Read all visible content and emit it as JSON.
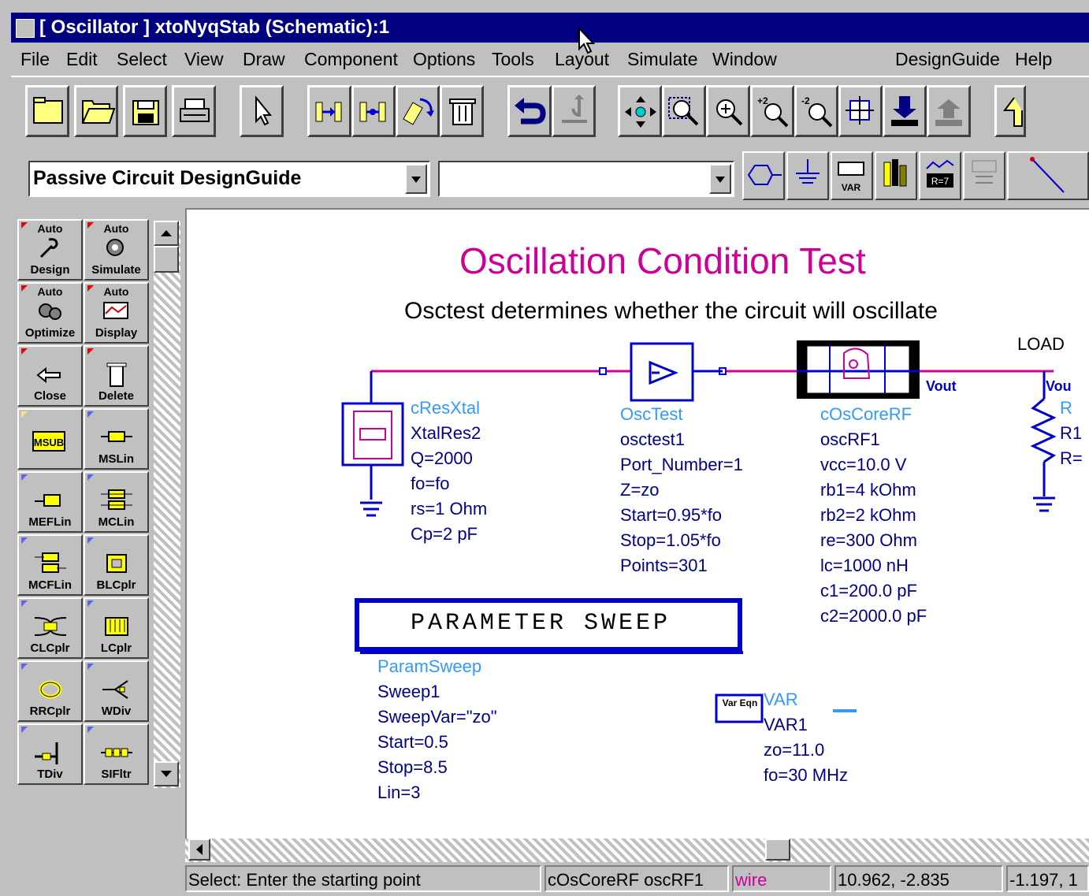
{
  "window": {
    "title": "[ Oscillator ] xtoNyqStab (Schematic):1"
  },
  "menu": [
    "File",
    "Edit",
    "Select",
    "View",
    "Draw",
    "Component",
    "Options",
    "Tools",
    "Layout",
    "Simulate",
    "Window",
    "DesignGuide",
    "Help"
  ],
  "toolbar1_icons": [
    "new-icon",
    "open-icon",
    "save-icon",
    "print-icon",
    "select-arrow-icon",
    "insert-left-icon",
    "insert-right-icon",
    "rotate-icon",
    "delete-icon",
    "undo-icon",
    "redo-icon",
    "pan-icon",
    "zoom-area-icon",
    "zoom-point-icon",
    "zoom-in-icon",
    "zoom-out-icon",
    "zoom-fit-icon",
    "push-down-icon",
    "pop-up-icon"
  ],
  "toolbar2": {
    "palette_combo_value": "Passive Circuit DesignGuide",
    "component_combo_value": "",
    "icons": [
      "port-icon",
      "ground-icon",
      "var-icon",
      "simulate-icon",
      "display-icon",
      "sweep-icon",
      "wire-icon"
    ],
    "var_label": "VAR"
  },
  "palette": [
    {
      "label": "Design",
      "auto": "Auto",
      "icon": "wrench-icon"
    },
    {
      "label": "Simulate",
      "auto": "Auto",
      "icon": "gears-icon"
    },
    {
      "label": "Optimize",
      "auto": "Auto",
      "icon": "gears-icon"
    },
    {
      "label": "Display",
      "auto": "Auto",
      "icon": "display-icon"
    },
    {
      "label": "Close",
      "auto": "",
      "icon": "arrow-left-icon"
    },
    {
      "label": "Delete",
      "auto": "",
      "icon": "trash-icon"
    },
    {
      "label": "MSUB",
      "auto": "",
      "icon": "msub-icon"
    },
    {
      "label": "MSLin",
      "auto": "",
      "icon": "line-icon"
    },
    {
      "label": "MEFLin",
      "auto": "",
      "icon": "line-icon"
    },
    {
      "label": "MCLin",
      "auto": "",
      "icon": "coupled-line-icon"
    },
    {
      "label": "MCFLin",
      "auto": "",
      "icon": "coupled-line-icon"
    },
    {
      "label": "BLCplr",
      "auto": "",
      "icon": "coupler-icon"
    },
    {
      "label": "CLCplr",
      "auto": "",
      "icon": "coupler-icon"
    },
    {
      "label": "LCplr",
      "auto": "",
      "icon": "lange-icon"
    },
    {
      "label": "RRCplr",
      "auto": "",
      "icon": "ring-icon"
    },
    {
      "label": "WDiv",
      "auto": "",
      "icon": "divider-icon"
    },
    {
      "label": "TDiv",
      "auto": "",
      "icon": "tee-icon"
    },
    {
      "label": "SIFltr",
      "auto": "",
      "icon": "filter-icon"
    }
  ],
  "schematic": {
    "title": "Oscillation Condition Test",
    "subtitle": "Osctest determines whether the circuit will oscillate",
    "load_label": "LOAD",
    "vout_label": "Vout",
    "vout_label2": "Vou",
    "xtal": [
      "cResXtal",
      "XtalRes2",
      "Q=2000",
      "fo=fo",
      "rs=1 Ohm",
      "Cp=2 pF"
    ],
    "osctest": [
      "OscTest",
      "osctest1",
      "Port_Number=1",
      "Z=zo",
      "Start=0.95*fo",
      "Stop=1.05*fo",
      "Points=301"
    ],
    "osccore": [
      "cOsCoreRF",
      "oscRF1",
      "vcc=10.0 V",
      "rb1=4 kOhm",
      "rb2=2 kOhm",
      "re=300 Ohm",
      "lc=1000 nH",
      "c1=200.0 pF",
      "c2=2000.0 pF"
    ],
    "resistor": [
      "R",
      "R1",
      "R="
    ],
    "sweep_box": "PARAMETER SWEEP",
    "sweep": [
      "ParamSweep",
      "Sweep1",
      "SweepVar=\"zo\"",
      "Start=0.5",
      "Stop=8.5",
      "Lin=3"
    ],
    "var_icon_text": "Var Eqn",
    "var": [
      "VAR",
      "VAR1",
      "zo=11.0",
      "fo=30 MHz"
    ]
  },
  "status": {
    "prompt": "Select: Enter the starting point",
    "component": "cOsCoreRF oscRF1",
    "mode": "wire",
    "coord1": "10.962, -2.835",
    "coord2": "-1.197, 1"
  },
  "colors": {
    "title_bar": "#000080",
    "wire": "#cc0099",
    "component_blue": "#0000cc",
    "component_name": "#3399ff",
    "title_text": "#cc0099"
  }
}
